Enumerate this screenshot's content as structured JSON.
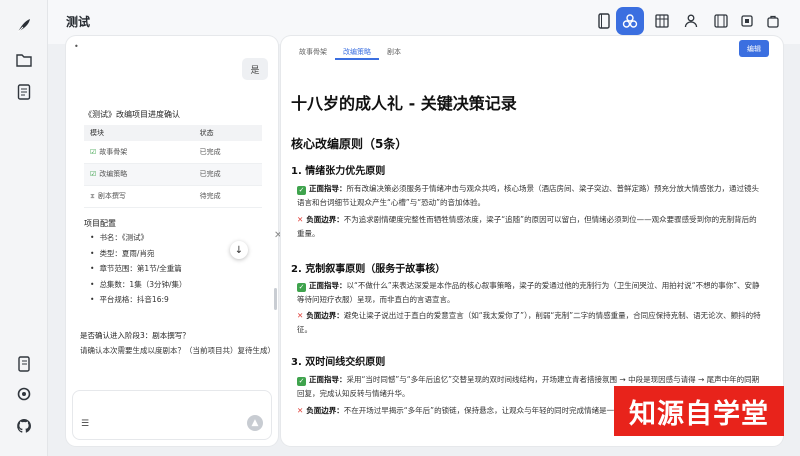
{
  "app": {
    "title": "测试"
  },
  "chat": {
    "dot": "•",
    "user_bubble": "是",
    "confirm_title": "《测试》改编项目进度确认",
    "table": {
      "headers": [
        "模块",
        "状态"
      ],
      "rows": [
        {
          "module": "故事骨架",
          "status": "已完成",
          "done": true
        },
        {
          "module": "改编策略",
          "status": "已完成",
          "done": true
        },
        {
          "module": "剧本撰写",
          "status": "待完成",
          "done": false
        }
      ]
    },
    "config_title": "项目配置",
    "config": [
      "书名：《测试》",
      "类型：夏雨/肖宛",
      "章节范围：第1节/全重篇",
      "总集数：1集（3分钟/集）",
      "平台规格：抖音16:9"
    ],
    "question": "是否确认进入阶段3：剧本撰写？",
    "question_detail": "请确认本次需要生成以度剧本？（当前项目共）复待生成）",
    "input_icon": "☰",
    "send_icon": "▲",
    "scroll_down_icon": "↓"
  },
  "doc": {
    "tabs": [
      "故事骨架",
      "改编策略",
      "剧本"
    ],
    "active_tab": 1,
    "edit_label": "编辑",
    "title": "十八岁的成人礼 - 关键决策记录",
    "section_title": "核心改编原则（5条）",
    "principles": [
      {
        "heading": "1. 情绪张力优先原则",
        "guide_label": "正面指导：",
        "guide": "所有改编决策必须服务于情绪冲击与观众共鸣，核心场景（酒店房间、梁子突边、普鲜定路）预充分放大情感张力，通过镜头语言和台词细节让观众产生“心槽”与“恐动”的音加体验。",
        "bound_label": "负面边界：",
        "bound": "不为追求剧情硬度完整性而牺牲情感浓度，梁子“追随”的原因可以留白，但情绪必须到位——观众要骤感受到你的克制背后的重量。"
      },
      {
        "heading": "2. 克制叙事原则（服务于故事核）",
        "guide_label": "正面指导：",
        "guide": "以“不做什么”来表达深爱是本作品的核心叙事策略，梁子的爱通过他的克制行为（卫生间哭泣、用拍衬说“不想的事你”、安静等待问短疗衣服）呈现，而非直白的言语宣言。",
        "bound_label": "负面边界：",
        "bound": "避免让梁子说出过于直白的爱意宣言（如“我太爱你了”），削弱“克制”二字的情感重量，合同应保持克制、语无论次、颤抖的特征。"
      },
      {
        "heading": "3. 双时间线交织原则",
        "guide_label": "正面指导：",
        "guide": "采用“当时同憾”与“多年后追忆”交替呈现的双时间线结构，开场建立青者措接氛围 → 中段是现因感与请得 → 尾声中年的同期回复，完成认知反转与情绪升华。",
        "bound_label": "负面边界：",
        "bound": "不在开场过早揭示“多年后”的锁链，保持悬念，让观众与年轻的同时完成情绪是一起诗语。"
      }
    ]
  },
  "watermark": "知源自学堂",
  "colors": {
    "accent": "#3b6fe0",
    "ok": "#3fa34d",
    "no": "#e0403a",
    "watermark": "#e8231b"
  }
}
